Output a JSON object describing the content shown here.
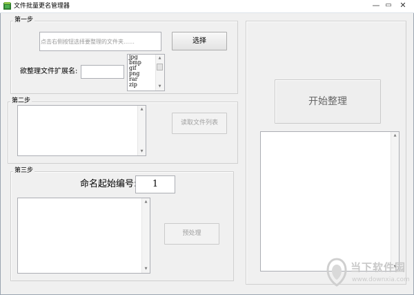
{
  "window": {
    "title": "文件批量更名管理器",
    "controls": {
      "minimize": "—",
      "maximize": "▭",
      "close": "✕"
    }
  },
  "step1": {
    "legend": "第一步",
    "folder_placeholder": "点击右侧按钮选择要整理的文件夹……",
    "select_button": "选择",
    "ext_label": "欲整理文件扩展名:",
    "ext_value": "",
    "extensions": [
      "jpg",
      "bmp",
      "gif",
      "png",
      "rar",
      "zip"
    ]
  },
  "step2": {
    "legend": "第二步",
    "read_button": "读取文件列表"
  },
  "step3": {
    "legend": "第三步",
    "start_number_label": "命名起始编号:",
    "start_number_value": "1",
    "preprocess_button": "预处理"
  },
  "start_button": "开始整理",
  "watermark": {
    "name": "当下软件园",
    "url": "www.downxia.com",
    "colors": {
      "logo": "#cfcfcf"
    }
  }
}
